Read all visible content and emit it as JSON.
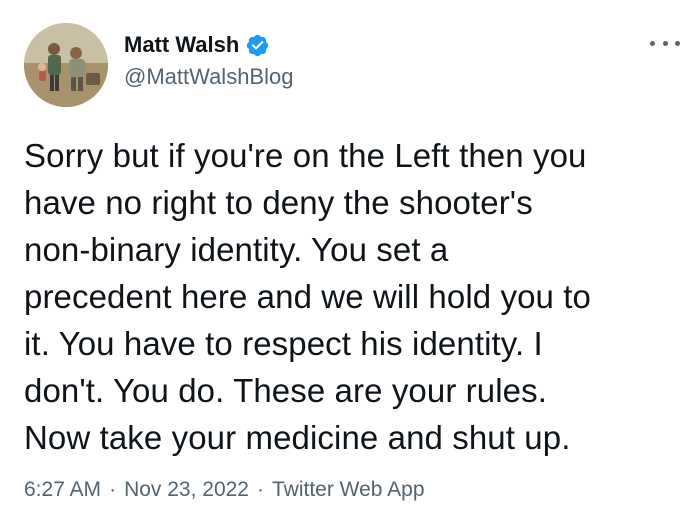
{
  "author": {
    "display_name": "Matt Walsh",
    "handle": "@MattWalshBlog",
    "verified_icon": "verified-badge-icon",
    "accent_color": "#1d9bf0"
  },
  "tweet": {
    "text": "Sorry but if you're on the Left then you\nhave no right to deny the shooter's\nnon-binary identity. You set a\nprecedent here and we will hold you to\nit. You have to respect his identity. I\ndon't. You do. These are your rules.\nNow take your medicine and shut up."
  },
  "meta": {
    "time": "6:27 AM",
    "separator": "·",
    "date": "Nov 23, 2022",
    "source": "Twitter Web App"
  },
  "icons": {
    "more": "more-options-icon"
  }
}
